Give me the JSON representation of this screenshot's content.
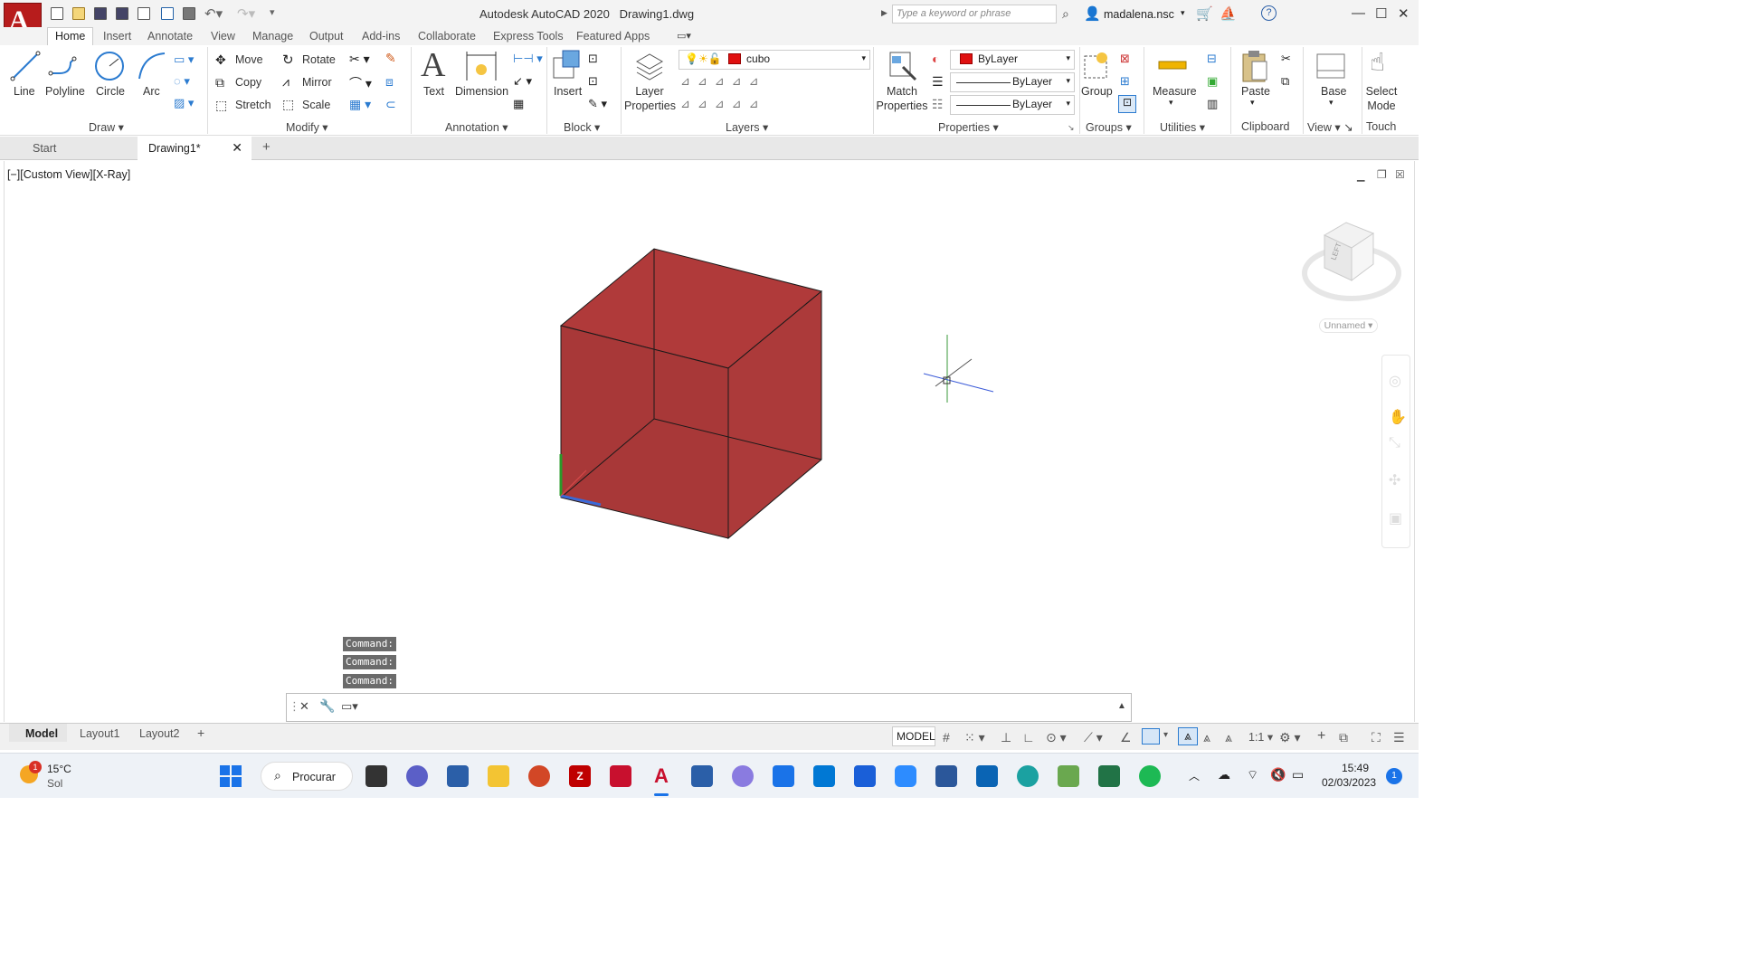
{
  "title_bar": {
    "app_title": "Autodesk AutoCAD 2020",
    "doc_title": "Drawing1.dwg",
    "search_placeholder": "Type a keyword or phrase",
    "user": "madalena.nsc"
  },
  "ribbon_tabs": [
    "Home",
    "Insert",
    "Annotate",
    "View",
    "Manage",
    "Output",
    "Add-ins",
    "Collaborate",
    "Express Tools",
    "Featured Apps"
  ],
  "ribbon": {
    "draw": {
      "title": "Draw",
      "line": "Line",
      "polyline": "Polyline",
      "circle": "Circle",
      "arc": "Arc"
    },
    "modify": {
      "title": "Modify",
      "move": "Move",
      "rotate": "Rotate",
      "copy": "Copy",
      "mirror": "Mirror",
      "stretch": "Stretch",
      "scale": "Scale"
    },
    "annotation": {
      "title": "Annotation",
      "text": "Text",
      "dimension": "Dimension"
    },
    "block": {
      "title": "Block",
      "insert": "Insert"
    },
    "layers": {
      "title": "Layers",
      "layer_properties_1": "Layer",
      "layer_properties_2": "Properties",
      "current_layer": "cubo"
    },
    "properties": {
      "title": "Properties",
      "match_1": "Match",
      "match_2": "Properties",
      "color": "ByLayer",
      "linetype": "ByLayer",
      "lineweight": "ByLayer"
    },
    "groups": {
      "title": "Groups",
      "group": "Group"
    },
    "utilities": {
      "title": "Utilities",
      "measure": "Measure"
    },
    "clipboard": {
      "title": "Clipboard",
      "paste": "Paste"
    },
    "view": {
      "title": "View",
      "base": "Base"
    },
    "touch": {
      "title": "Touch",
      "select_1": "Select",
      "select_2": "Mode"
    }
  },
  "doc_tabs": {
    "start": "Start",
    "drawing": "Drawing1*"
  },
  "viewport": {
    "label": "[−][Custom View][X-Ray]",
    "viewcube_label": "Unnamed",
    "cube_color": "#b03a3a"
  },
  "command_history": [
    "Command:",
    "Command:",
    "Command:"
  ],
  "layout_tabs": [
    "Model",
    "Layout1",
    "Layout2"
  ],
  "status": {
    "model": "MODEL",
    "scale": "1:1"
  },
  "taskbar": {
    "weather_temp": "15°C",
    "weather_desc": "Sol",
    "weather_badge": "1",
    "search": "Procurar",
    "time": "15:49",
    "date": "02/03/2023",
    "notif": "1"
  }
}
